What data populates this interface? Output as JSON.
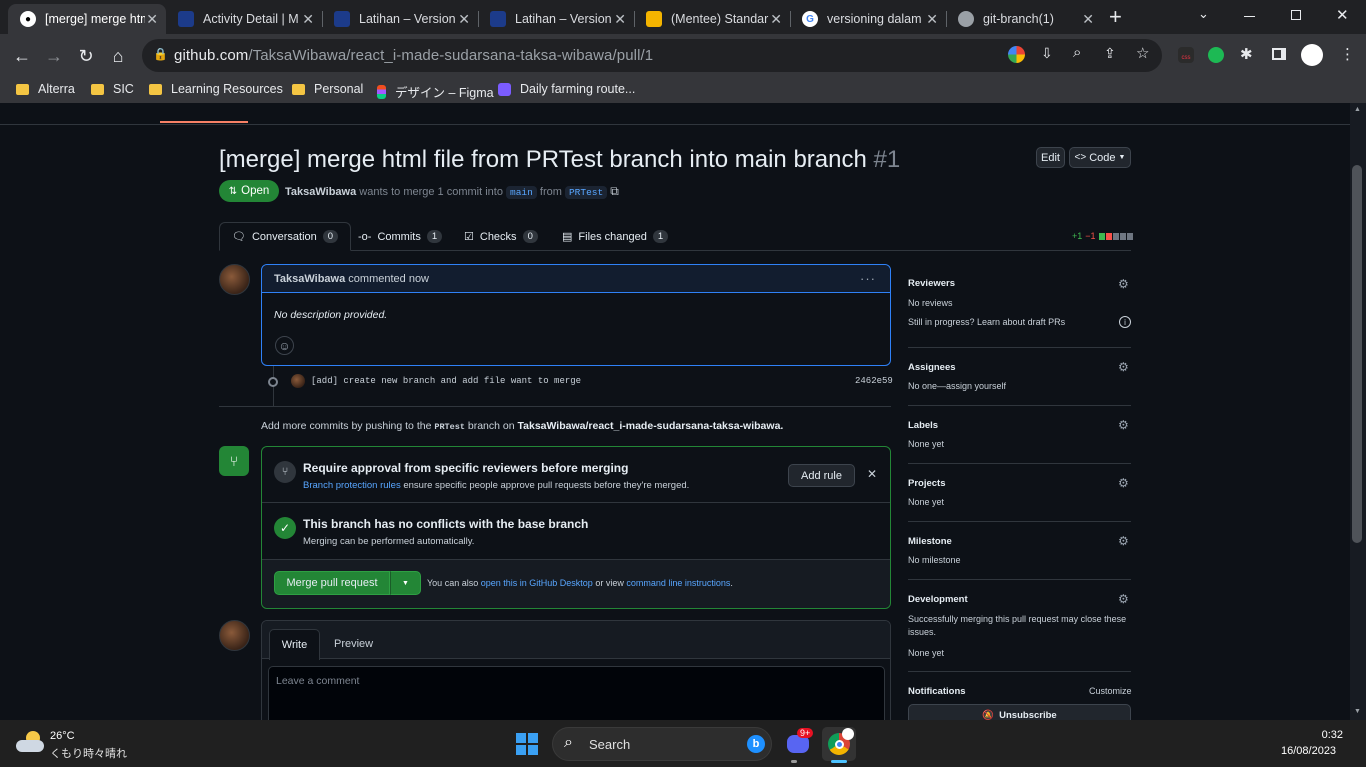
{
  "browser": {
    "tabs": [
      {
        "title": "[merge] merge html"
      },
      {
        "title": "Activity Detail | M"
      },
      {
        "title": "Latihan – Version"
      },
      {
        "title": "Latihan – Version"
      },
      {
        "title": "(Mentee) Standar"
      },
      {
        "title": "versioning dalam"
      },
      {
        "title": "git-branch(1)"
      }
    ],
    "url_host": "github.com",
    "url_path": "/TaksaWibawa/react_i-made-sudarsana-taksa-wibawa/pull/1",
    "bookmarks": [
      "Alterra",
      "SIC",
      "Learning Resources",
      "Personal",
      "デザイン – Figma",
      "Daily farming route..."
    ]
  },
  "pr": {
    "title": "[merge] merge html file from PRTest branch into main branch",
    "number": "#1",
    "edit_label": "Edit",
    "code_label": "Code",
    "status": "Open",
    "author": "TaksaWibawa",
    "meta_text": "wants to merge 1 commit into",
    "base_branch": "main",
    "from_text": "from",
    "head_branch": "PRTest",
    "tabs": [
      {
        "label": "Conversation",
        "count": "0"
      },
      {
        "label": "Commits",
        "count": "1"
      },
      {
        "label": "Checks",
        "count": "0"
      },
      {
        "label": "Files changed",
        "count": "1"
      }
    ],
    "diffstat_add": "+1",
    "diffstat_del": "−1"
  },
  "comment": {
    "author": "TaksaWibawa",
    "action": "commented now",
    "body": "No description provided."
  },
  "commit": {
    "message": "[add] create new branch and add file want to merge",
    "sha": "2462e59"
  },
  "push_hint": {
    "prefix": "Add more commits by pushing to the",
    "branch": "PRTest",
    "middle": "branch on",
    "repo": "TaksaWibawa/react_i-made-sudarsana-taksa-wibawa."
  },
  "merge": {
    "review_title": "Require approval from specific reviewers before merging",
    "review_link": "Branch protection rules",
    "review_desc": "ensure specific people approve pull requests before they're merged.",
    "add_rule": "Add rule",
    "conflict_title": "This branch has no conflicts with the base branch",
    "conflict_desc": "Merging can be performed automatically.",
    "merge_button": "Merge pull request",
    "also_text": "You can also",
    "desktop_link": "open this in GitHub Desktop",
    "or_view": "or view",
    "cli_link": "command line instructions",
    "period": "."
  },
  "editor": {
    "write_tab": "Write",
    "preview_tab": "Preview",
    "placeholder": "Leave a comment"
  },
  "sidebar": {
    "reviewers": {
      "heading": "Reviewers",
      "value": "No reviews",
      "note": "Still in progress? Learn about draft PRs"
    },
    "assignees": {
      "heading": "Assignees",
      "value": "No one—assign yourself"
    },
    "labels": {
      "heading": "Labels",
      "value": "None yet"
    },
    "projects": {
      "heading": "Projects",
      "value": "None yet"
    },
    "milestone": {
      "heading": "Milestone",
      "value": "No milestone"
    },
    "development": {
      "heading": "Development",
      "value": "Successfully merging this pull request may close these issues.",
      "value2": "None yet"
    },
    "notifications": {
      "heading": "Notifications",
      "customize": "Customize",
      "unsubscribe": "Unsubscribe"
    }
  },
  "taskbar": {
    "temp": "26°C",
    "weather": "くもり時々晴れ",
    "search": "Search",
    "discord_badge": "9+",
    "time": "0:32",
    "date": "16/08/2023"
  }
}
